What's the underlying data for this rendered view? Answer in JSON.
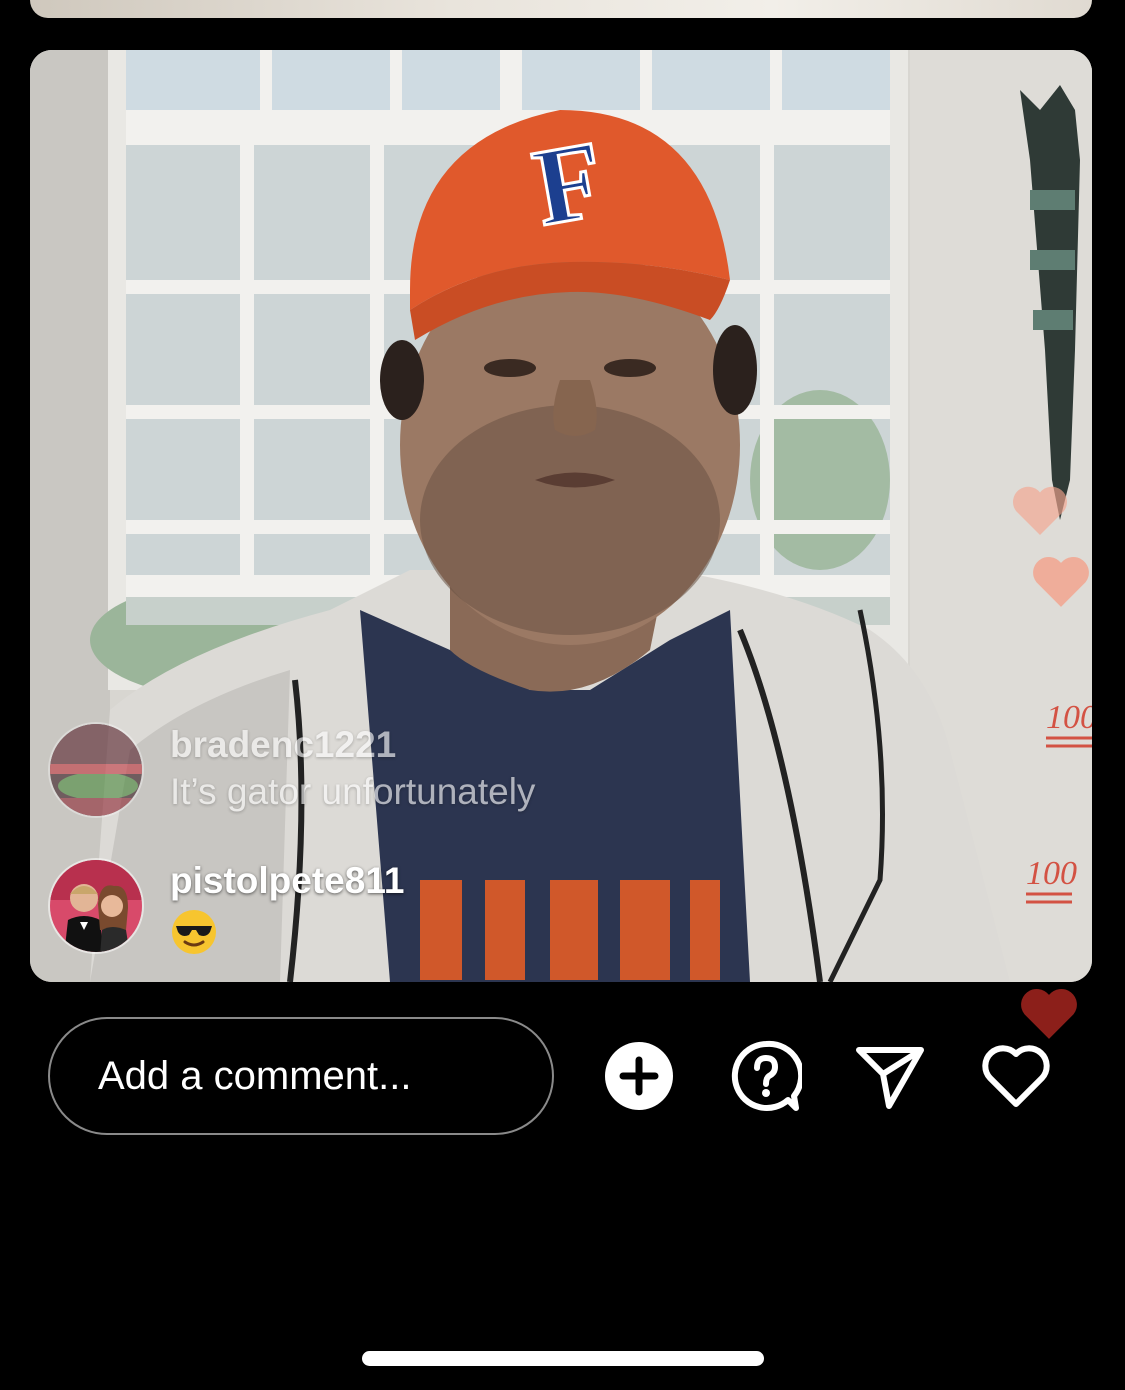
{
  "live": {
    "comments": [
      {
        "username": "bradenc1221",
        "message": "It’s gator unfortunately",
        "avatar_icon": "stadium-avatar"
      },
      {
        "username": "pistolpete811",
        "message": "😎",
        "avatar_icon": "couple-avatar"
      }
    ],
    "reactions": [
      "heart",
      "heart",
      "heart",
      "hundred-points",
      "hundred-points"
    ],
    "hat_letter": "F"
  },
  "bottom_bar": {
    "comment_placeholder": "Add a comment...",
    "icons": [
      "add-icon",
      "question-icon",
      "send-icon",
      "heart-icon"
    ]
  },
  "colors": {
    "background": "#000000",
    "hat": "#e0592c",
    "letter": "#1c3f8f",
    "heart_reaction": "#f2a58f"
  }
}
